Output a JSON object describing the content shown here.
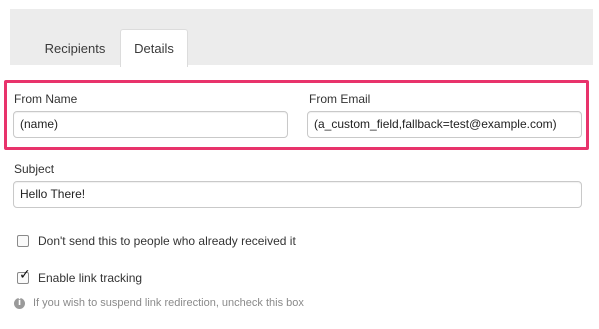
{
  "tabs": [
    {
      "label": "Recipients",
      "active": false
    },
    {
      "label": "Details",
      "active": true
    }
  ],
  "from_name": {
    "label": "From Name",
    "value": "(name)"
  },
  "from_email": {
    "label": "From Email",
    "value": "(a_custom_field,fallback=test@example.com)"
  },
  "subject": {
    "label": "Subject",
    "value": "Hello There!"
  },
  "options": {
    "no_resend": {
      "label": "Don't send this to people who already received it",
      "checked": false
    },
    "link_tracking": {
      "label": "Enable link tracking",
      "checked": true
    }
  },
  "hint": {
    "text": "If you wish to suspend link redirection, uncheck this box",
    "icon": "info-icon"
  },
  "colors": {
    "highlight": "#e8336b",
    "tabbar": "#ececec"
  }
}
